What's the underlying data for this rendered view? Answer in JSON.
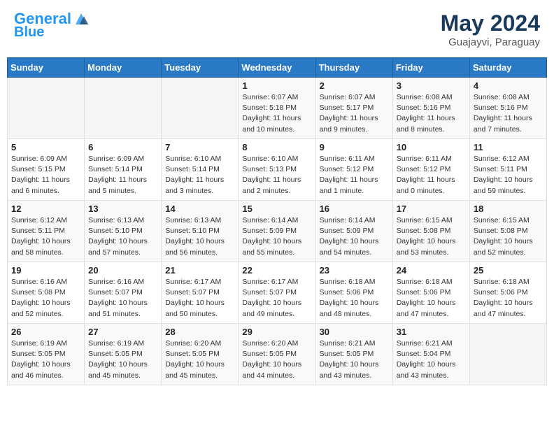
{
  "header": {
    "logo_line1": "General",
    "logo_line2": "Blue",
    "month": "May 2024",
    "location": "Guajayvi, Paraguay"
  },
  "weekdays": [
    "Sunday",
    "Monday",
    "Tuesday",
    "Wednesday",
    "Thursday",
    "Friday",
    "Saturday"
  ],
  "weeks": [
    [
      {
        "day": "",
        "info": ""
      },
      {
        "day": "",
        "info": ""
      },
      {
        "day": "",
        "info": ""
      },
      {
        "day": "1",
        "info": "Sunrise: 6:07 AM\nSunset: 5:18 PM\nDaylight: 11 hours\nand 10 minutes."
      },
      {
        "day": "2",
        "info": "Sunrise: 6:07 AM\nSunset: 5:17 PM\nDaylight: 11 hours\nand 9 minutes."
      },
      {
        "day": "3",
        "info": "Sunrise: 6:08 AM\nSunset: 5:16 PM\nDaylight: 11 hours\nand 8 minutes."
      },
      {
        "day": "4",
        "info": "Sunrise: 6:08 AM\nSunset: 5:16 PM\nDaylight: 11 hours\nand 7 minutes."
      }
    ],
    [
      {
        "day": "5",
        "info": "Sunrise: 6:09 AM\nSunset: 5:15 PM\nDaylight: 11 hours\nand 6 minutes."
      },
      {
        "day": "6",
        "info": "Sunrise: 6:09 AM\nSunset: 5:14 PM\nDaylight: 11 hours\nand 5 minutes."
      },
      {
        "day": "7",
        "info": "Sunrise: 6:10 AM\nSunset: 5:14 PM\nDaylight: 11 hours\nand 3 minutes."
      },
      {
        "day": "8",
        "info": "Sunrise: 6:10 AM\nSunset: 5:13 PM\nDaylight: 11 hours\nand 2 minutes."
      },
      {
        "day": "9",
        "info": "Sunrise: 6:11 AM\nSunset: 5:12 PM\nDaylight: 11 hours\nand 1 minute."
      },
      {
        "day": "10",
        "info": "Sunrise: 6:11 AM\nSunset: 5:12 PM\nDaylight: 11 hours\nand 0 minutes."
      },
      {
        "day": "11",
        "info": "Sunrise: 6:12 AM\nSunset: 5:11 PM\nDaylight: 10 hours\nand 59 minutes."
      }
    ],
    [
      {
        "day": "12",
        "info": "Sunrise: 6:12 AM\nSunset: 5:11 PM\nDaylight: 10 hours\nand 58 minutes."
      },
      {
        "day": "13",
        "info": "Sunrise: 6:13 AM\nSunset: 5:10 PM\nDaylight: 10 hours\nand 57 minutes."
      },
      {
        "day": "14",
        "info": "Sunrise: 6:13 AM\nSunset: 5:10 PM\nDaylight: 10 hours\nand 56 minutes."
      },
      {
        "day": "15",
        "info": "Sunrise: 6:14 AM\nSunset: 5:09 PM\nDaylight: 10 hours\nand 55 minutes."
      },
      {
        "day": "16",
        "info": "Sunrise: 6:14 AM\nSunset: 5:09 PM\nDaylight: 10 hours\nand 54 minutes."
      },
      {
        "day": "17",
        "info": "Sunrise: 6:15 AM\nSunset: 5:08 PM\nDaylight: 10 hours\nand 53 minutes."
      },
      {
        "day": "18",
        "info": "Sunrise: 6:15 AM\nSunset: 5:08 PM\nDaylight: 10 hours\nand 52 minutes."
      }
    ],
    [
      {
        "day": "19",
        "info": "Sunrise: 6:16 AM\nSunset: 5:08 PM\nDaylight: 10 hours\nand 52 minutes."
      },
      {
        "day": "20",
        "info": "Sunrise: 6:16 AM\nSunset: 5:07 PM\nDaylight: 10 hours\nand 51 minutes."
      },
      {
        "day": "21",
        "info": "Sunrise: 6:17 AM\nSunset: 5:07 PM\nDaylight: 10 hours\nand 50 minutes."
      },
      {
        "day": "22",
        "info": "Sunrise: 6:17 AM\nSunset: 5:07 PM\nDaylight: 10 hours\nand 49 minutes."
      },
      {
        "day": "23",
        "info": "Sunrise: 6:18 AM\nSunset: 5:06 PM\nDaylight: 10 hours\nand 48 minutes."
      },
      {
        "day": "24",
        "info": "Sunrise: 6:18 AM\nSunset: 5:06 PM\nDaylight: 10 hours\nand 47 minutes."
      },
      {
        "day": "25",
        "info": "Sunrise: 6:18 AM\nSunset: 5:06 PM\nDaylight: 10 hours\nand 47 minutes."
      }
    ],
    [
      {
        "day": "26",
        "info": "Sunrise: 6:19 AM\nSunset: 5:05 PM\nDaylight: 10 hours\nand 46 minutes."
      },
      {
        "day": "27",
        "info": "Sunrise: 6:19 AM\nSunset: 5:05 PM\nDaylight: 10 hours\nand 45 minutes."
      },
      {
        "day": "28",
        "info": "Sunrise: 6:20 AM\nSunset: 5:05 PM\nDaylight: 10 hours\nand 45 minutes."
      },
      {
        "day": "29",
        "info": "Sunrise: 6:20 AM\nSunset: 5:05 PM\nDaylight: 10 hours\nand 44 minutes."
      },
      {
        "day": "30",
        "info": "Sunrise: 6:21 AM\nSunset: 5:05 PM\nDaylight: 10 hours\nand 43 minutes."
      },
      {
        "day": "31",
        "info": "Sunrise: 6:21 AM\nSunset: 5:04 PM\nDaylight: 10 hours\nand 43 minutes."
      },
      {
        "day": "",
        "info": ""
      }
    ]
  ]
}
